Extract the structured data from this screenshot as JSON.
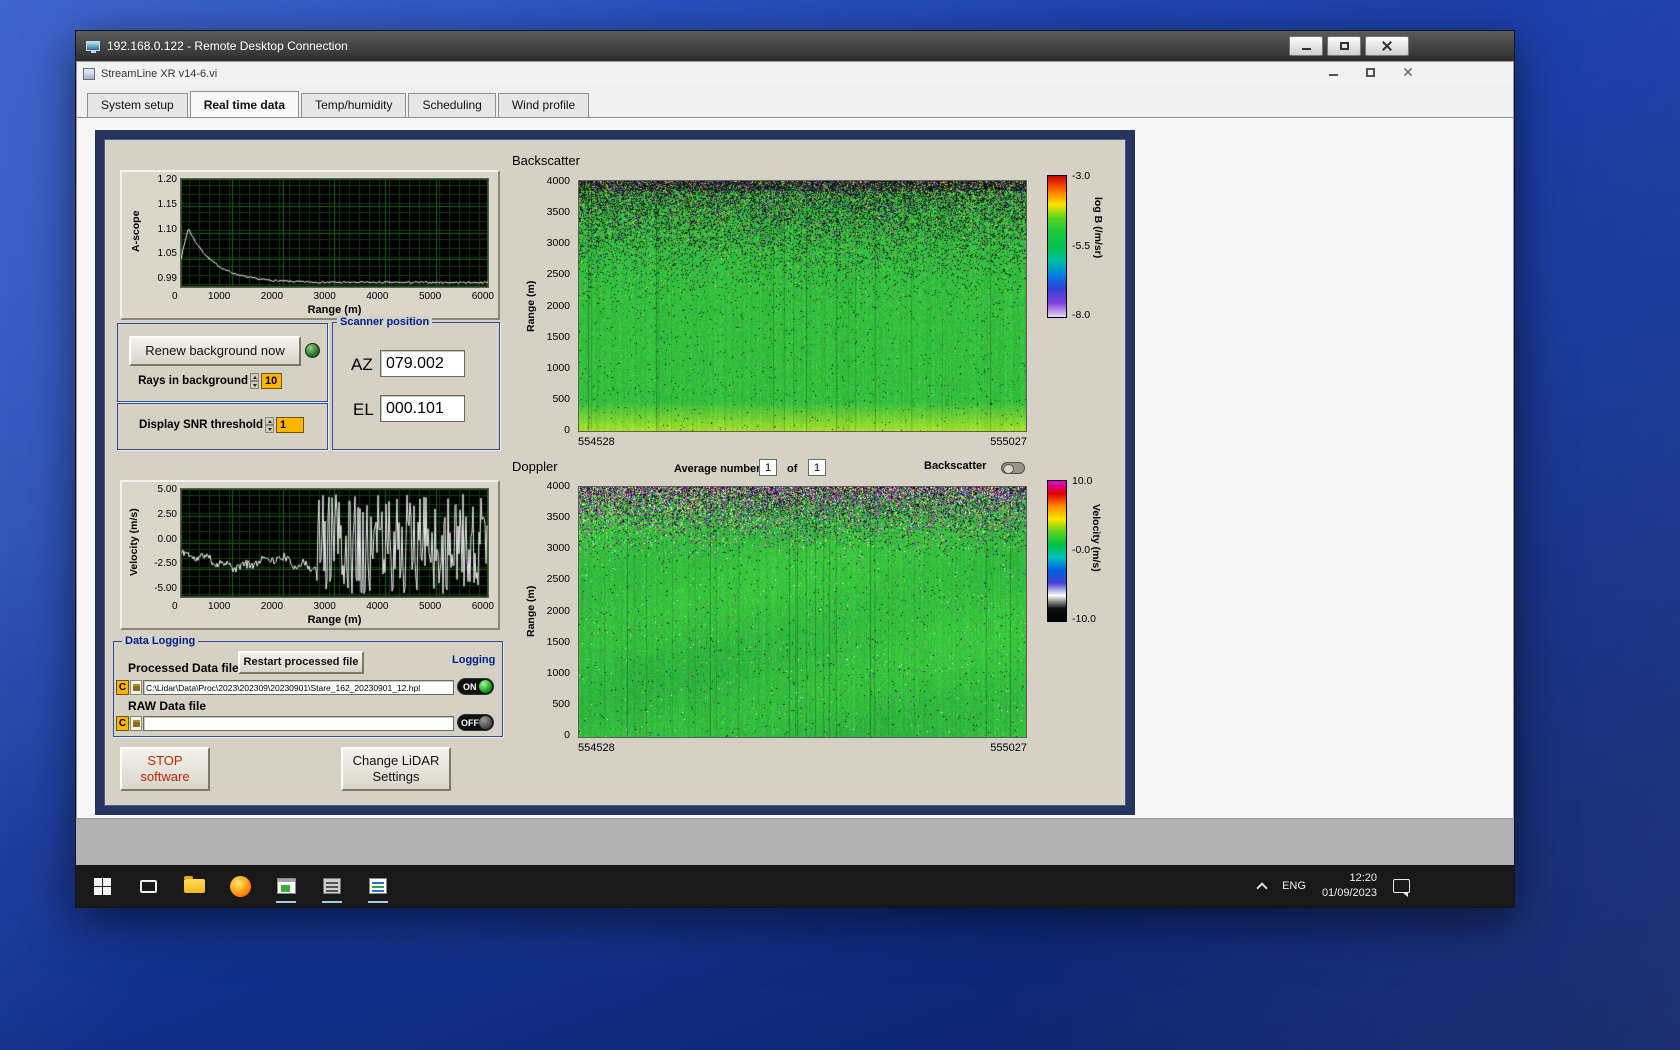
{
  "rdp": {
    "title": "192.168.0.122 - Remote Desktop Connection"
  },
  "app": {
    "title": "StreamLine XR v14-6.vi",
    "active_tab": "Real time data",
    "tabs": [
      {
        "label": "System setup"
      },
      {
        "label": "Real time data"
      },
      {
        "label": "Temp/humidity"
      },
      {
        "label": "Scheduling"
      },
      {
        "label": "Wind profile"
      }
    ]
  },
  "ascope": {
    "ylabel": "A-scope",
    "xlabel": "Range (m)",
    "yticks": [
      "1.20",
      "1.15",
      "1.10",
      "1.05",
      "0.99"
    ],
    "xticks": [
      "0",
      "1000",
      "2000",
      "3000",
      "4000",
      "5000",
      "6000"
    ]
  },
  "background_controls": {
    "renew_button": "Renew background now",
    "rays_label": "Rays in background",
    "rays_value": "10",
    "snr_label": "Display SNR threshold",
    "snr_value": "1"
  },
  "scanner": {
    "title": "Scanner position",
    "az_label": "AZ",
    "az_value": "079.002",
    "el_label": "EL",
    "el_value": "000.101"
  },
  "velocity_plot": {
    "ylabel": "Velocity (m/s)",
    "xlabel": "Range (m)",
    "yticks": [
      "5.00",
      "2.50",
      "0.00",
      "-2.50",
      "-5.00"
    ],
    "xticks": [
      "0",
      "1000",
      "2000",
      "3000",
      "4000",
      "5000",
      "6000"
    ]
  },
  "backscatter": {
    "title": "Backscatter",
    "ylabel": "Range (m)",
    "yticks": [
      "4000",
      "3500",
      "3000",
      "2500",
      "2000",
      "1500",
      "1000",
      "500",
      "0"
    ],
    "x_start": "554528",
    "x_end": "555027",
    "colorbar_label": "log B (/m/sr)",
    "colorbar_ticks": [
      "-3.0",
      "-5.5",
      "-8.0"
    ],
    "colorbar_colors": [
      "#c80000",
      "#ff6a00",
      "#ffe400",
      "#55d41e",
      "#1ec83c",
      "#00c24a",
      "#00c0a0",
      "#0080e0",
      "#3040d8",
      "#8040d8",
      "#e8d8f8"
    ]
  },
  "doppler": {
    "title": "Doppler",
    "average_label": "Average number",
    "average_value": "1",
    "of_label": "of",
    "of_value": "1",
    "toggle_label": "Backscatter",
    "ylabel": "Range (m)",
    "yticks": [
      "4000",
      "3500",
      "3000",
      "2500",
      "2000",
      "1500",
      "1000",
      "500",
      "0"
    ],
    "x_start": "554528",
    "x_end": "555027",
    "colorbar_label": "Velocity (m/s)",
    "colorbar_ticks": [
      "10.0",
      "-0.0",
      "-10.0"
    ],
    "colorbar_colors": [
      "#d800d8",
      "#e00000",
      "#ff8c00",
      "#ffe400",
      "#58d41e",
      "#00c040",
      "#00c0c0",
      "#0060e0",
      "#4040d0",
      "#ffffff",
      "#101010",
      "#000000"
    ]
  },
  "data_logging": {
    "title": "Data Logging",
    "processed_label": "Processed Data file",
    "restart_button": "Restart processed file",
    "logging_label": "Logging",
    "drive": "C",
    "processed_path": "C:\\Lidar\\Data\\Proc\\2023\\202309\\20230901\\Stare_162_20230901_12.hpl",
    "on_label": "ON",
    "raw_label": "RAW Data file",
    "raw_path": "",
    "off_label": "OFF"
  },
  "footer": {
    "stop_line1": "STOP",
    "stop_line2": "software",
    "change_line1": "Change LiDAR",
    "change_line2": "Settings"
  },
  "taskbar": {
    "language": "ENG",
    "time": "12:20",
    "date": "01/09/2023",
    "icons": [
      "start",
      "task-view",
      "file-explorer",
      "firefox",
      "streamline-app",
      "scan-scheduler",
      "text-editor"
    ],
    "tray_icons": [
      "hidden-icons-chevron",
      "notification-center"
    ]
  }
}
